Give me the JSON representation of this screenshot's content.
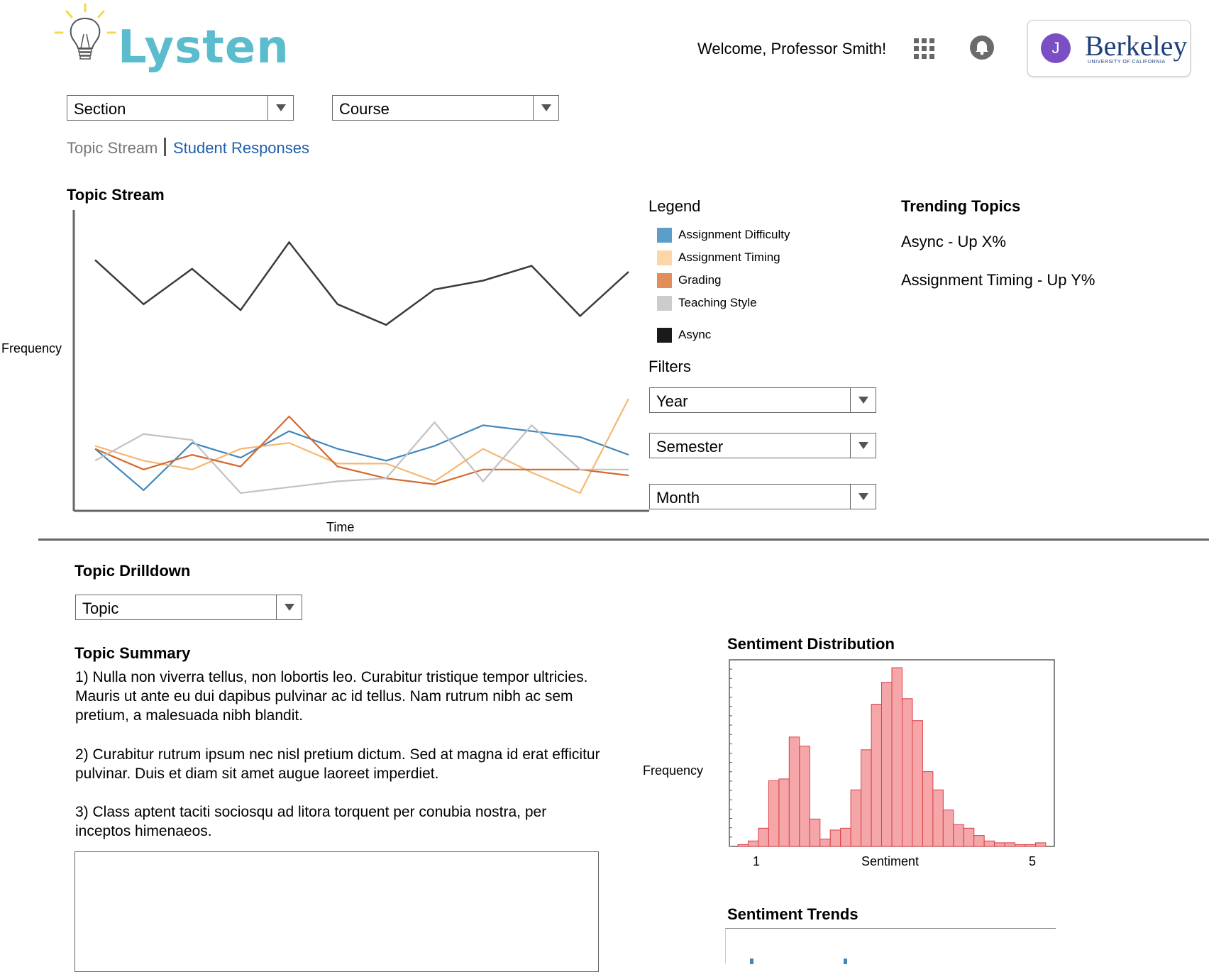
{
  "header": {
    "app_name": "Lysten",
    "welcome": "Welcome, Professor Smith!",
    "avatar_initial": "J",
    "institution": "Berkeley",
    "institution_sub": "UNIVERSITY OF CALIFORNIA"
  },
  "filters_top": {
    "section": "Section",
    "course": "Course"
  },
  "nav": {
    "tab_topic_stream": "Topic Stream",
    "tab_student_responses": "Student Responses",
    "link_color": "#1f5fa8"
  },
  "topic_stream": {
    "title": "Topic Stream",
    "ylabel": "Frequency",
    "xlabel": "Time"
  },
  "legend": {
    "title": "Legend",
    "items": [
      {
        "label": "Assignment Difficulty",
        "color": "#5a9ec9"
      },
      {
        "label": "Assignment Timing",
        "color": "#fcd5a8"
      },
      {
        "label": "Grading",
        "color": "#e08f5a"
      },
      {
        "label": "Teaching Style",
        "color": "#cccccc"
      },
      {
        "label": "Async",
        "color": "#1a1a1a"
      }
    ]
  },
  "filters": {
    "title": "Filters",
    "year": "Year",
    "semester": "Semester",
    "month": "Month"
  },
  "trending": {
    "title": "Trending Topics",
    "items": [
      "Async - Up X%",
      "Assignment Timing - Up Y%"
    ]
  },
  "drilldown": {
    "title": "Topic Drilldown",
    "topic_select": "Topic",
    "summary_title": "Topic Summary",
    "summary": [
      "1) Nulla non viverra tellus, non lobortis leo. Curabitur tristique tempor ultricies. Mauris ut ante eu dui dapibus pulvinar ac id tellus. Nam rutrum nibh ac sem pretium, a malesuada nibh blandit.",
      "2) Curabitur rutrum ipsum nec nisl pretium dictum. Sed at magna id erat efficitur pulvinar. Duis et diam sit amet augue laoreet imperdiet.",
      "3) Class aptent taciti sociosqu ad litora torquent per conubia nostra, per inceptos himenaeos."
    ]
  },
  "sentiment": {
    "dist_title": "Sentiment Distribution",
    "ylabel": "Frequency",
    "xlabel": "Sentiment",
    "x_min_label": "1",
    "x_max_label": "5",
    "trends_title": "Sentiment Trends"
  },
  "chart_data": [
    {
      "type": "line",
      "x": [
        1,
        2,
        3,
        4,
        5,
        6,
        7,
        8,
        9,
        10,
        11,
        12
      ],
      "series": [
        {
          "name": "Async",
          "color": "#3a3a3a",
          "values": [
            85,
            70,
            82,
            68,
            91,
            70,
            63,
            75,
            78,
            83,
            66,
            81
          ]
        },
        {
          "name": "Assignment Difficulty",
          "color": "#3f86bd",
          "values": [
            21,
            7,
            23,
            18,
            27,
            21,
            17,
            22,
            29,
            27,
            25,
            19
          ]
        },
        {
          "name": "Assignment Timing",
          "color": "#f5b772",
          "values": [
            22,
            17,
            14,
            21,
            23,
            16,
            16,
            10,
            21,
            13,
            6,
            38
          ]
        },
        {
          "name": "Grading",
          "color": "#d2692e",
          "values": [
            21,
            14,
            19,
            15,
            32,
            15,
            11,
            9,
            14,
            14,
            14,
            12
          ]
        },
        {
          "name": "Teaching Style",
          "color": "#c2c2c2",
          "values": [
            17,
            26,
            24,
            6,
            8,
            10,
            11,
            30,
            10,
            29,
            14,
            14
          ]
        }
      ]
    },
    {
      "type": "bar",
      "xlabel": "Sentiment",
      "ylabel": "Frequency",
      "xlim": [
        1,
        5
      ],
      "values": [
        1,
        3,
        10,
        36,
        37,
        60,
        55,
        15,
        4,
        9,
        10,
        31,
        53,
        78,
        90,
        98,
        81,
        69,
        41,
        31,
        20,
        12,
        10,
        6,
        3,
        2,
        2,
        1,
        1,
        2
      ]
    }
  ]
}
